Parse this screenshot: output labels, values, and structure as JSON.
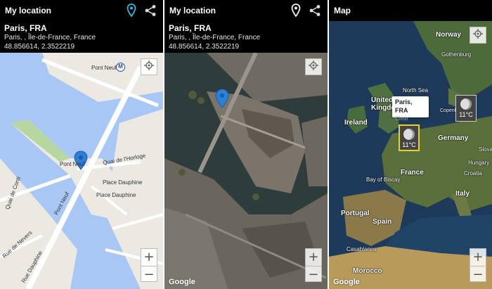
{
  "screens": [
    {
      "title": "My location",
      "city": "Paris, FRA",
      "region": "Paris, , Île-de-France, France",
      "coords": "48.856614, 2.3522219",
      "map_type": "street",
      "labels": {
        "pont_neuf_top": "Pont Neuf",
        "metro": "M",
        "pont_neuf_near": "Pont Neuf",
        "quai_horloge": "Quai de l'Horloge",
        "place_dauphine_1": "Place Dauphine",
        "place_dauphine_2": "Place Dauphine",
        "pont_neuf_diag": "Pont Neuf",
        "quai_conti": "Quai de Conti",
        "rue_nevers": "Rue de Nevers",
        "rue_dauphine": "Rue Dauphine"
      },
      "zoom_in": "+",
      "zoom_out": "−"
    },
    {
      "title": "My location",
      "city": "Paris, FRA",
      "region": "Paris, , Île-de-France, France",
      "coords": "48.856614, 2.3522219",
      "map_type": "satellite",
      "google": "Google",
      "zoom_in": "+",
      "zoom_out": "−"
    },
    {
      "title": "Map",
      "map_type": "satellite-weather",
      "countries": {
        "norway": "Norway",
        "gothenburg": "Gothenburg",
        "north_sea": "North Sea",
        "united_kingdom": "United Kingdom",
        "ireland": "Ireland",
        "copenhagen": "Copenhagen",
        "germany": "Germany",
        "france": "France",
        "bay_of_biscay": "Bay of Biscay",
        "portugal": "Portugal",
        "spain": "Spain",
        "italy": "Italy",
        "casablanca": "Casablanca",
        "morocco": "Morocco",
        "slovak": "Slovak",
        "hungary": "Hungary",
        "croatia": "Croatia"
      },
      "popup": {
        "city": "Paris, FRA",
        "condition": "Clear"
      },
      "weather_tiles": [
        {
          "temp": "11°C"
        },
        {
          "temp": "11°C"
        }
      ],
      "google": "Google",
      "zoom_in": "+",
      "zoom_out": "−"
    }
  ],
  "colors": {
    "bar": "#000000",
    "water_street": "#a9c7f5",
    "marker_blue": "#2e7fd8",
    "weather_highlight": "#e8d02a"
  }
}
